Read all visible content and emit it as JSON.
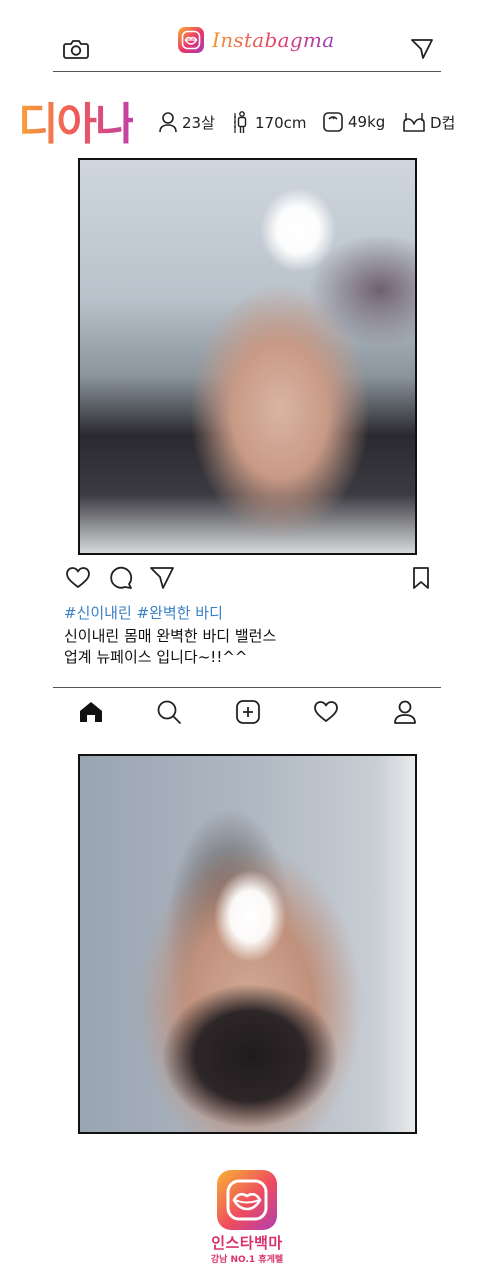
{
  "header": {
    "brand": "Instabagma"
  },
  "profile": {
    "name": "디아나",
    "stats": {
      "age": "23살",
      "height": "170cm",
      "weight": "49kg",
      "cup": "D컵"
    }
  },
  "post": {
    "hashtags": "#신이내린 #완벽한 바디",
    "caption_lines": [
      "신이내린 몸매 완벽한 바디 밸런스",
      "업계 뉴페이스 입니다~!!^^"
    ]
  },
  "footer": {
    "name": "인스타백마",
    "tagline": "강남 NO.1 휴게텔"
  },
  "colors": {
    "brand_orange": "#f2972e",
    "brand_pink": "#e23d6c",
    "brand_purple": "#9a3fbd",
    "hashtag_blue": "#3b82c4"
  }
}
